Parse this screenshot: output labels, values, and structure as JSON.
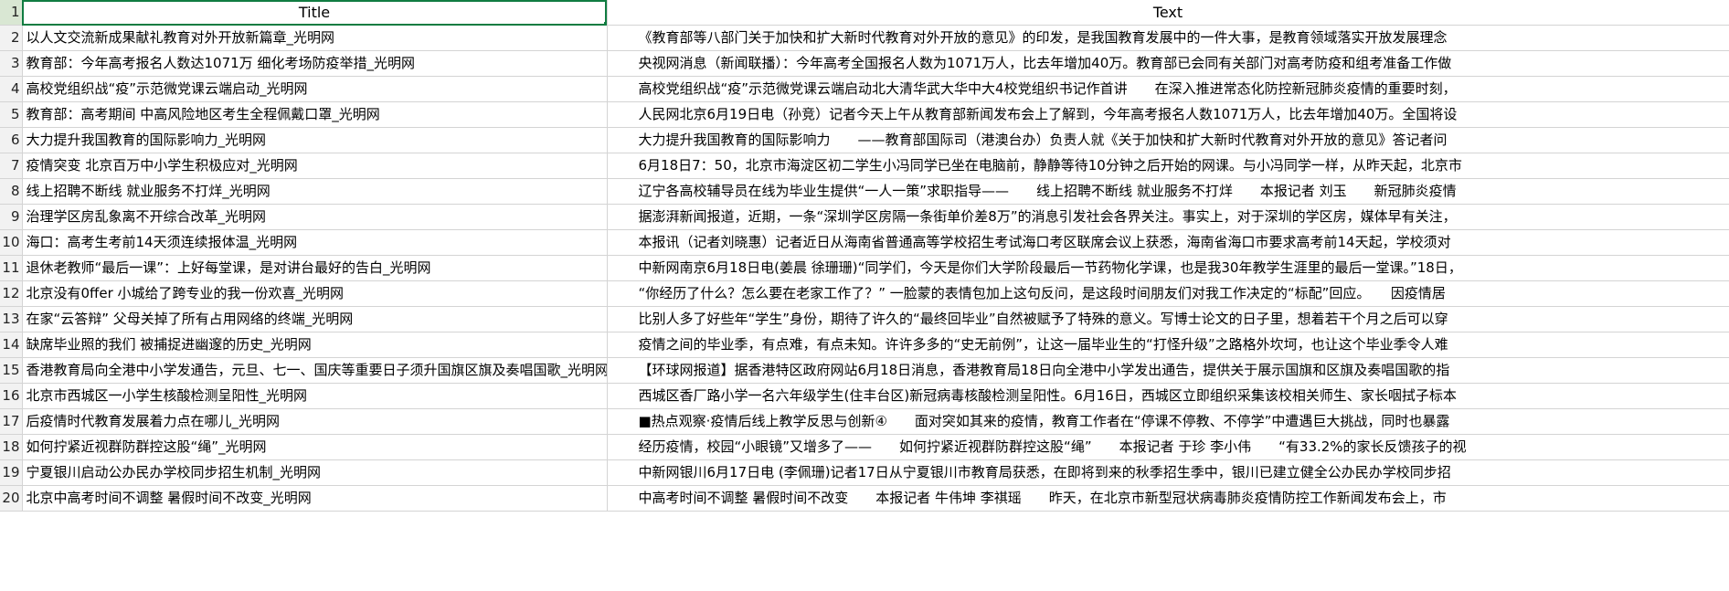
{
  "headers": {
    "title": "Title",
    "text": "Text"
  },
  "rows": [
    {
      "num": "1"
    },
    {
      "num": "2",
      "title": "以人文交流新成果献礼教育对外开放新篇章_光明网",
      "text": "《教育部等八部门关于加快和扩大新时代教育对外开放的意见》的印发，是我国教育发展中的一件大事，是教育领域落实开放发展理念"
    },
    {
      "num": "3",
      "title": "教育部：今年高考报名人数达1071万 细化考场防疫举措_光明网",
      "text": "央视网消息（新闻联播）：今年高考全国报名人数为1071万人，比去年增加40万。教育部已会同有关部门对高考防疫和组考准备工作做"
    },
    {
      "num": "4",
      "title": "高校党组织战“疫”示范微党课云端启动_光明网",
      "text": "高校党组织战“疫”示范微党课云端启动北大清华武大华中大4校党组织书记作首讲　　在深入推进常态化防控新冠肺炎疫情的重要时刻，"
    },
    {
      "num": "5",
      "title": "教育部：高考期间 中高风险地区考生全程佩戴口罩_光明网",
      "text": "人民网北京6月19日电（孙竞）记者今天上午从教育部新闻发布会上了解到，今年高考报名人数1071万人，比去年增加40万。全国将设"
    },
    {
      "num": "6",
      "title": "大力提升我国教育的国际影响力_光明网",
      "text": "大力提升我国教育的国际影响力　　——教育部国际司（港澳台办）负责人就《关于加快和扩大新时代教育对外开放的意见》答记者问"
    },
    {
      "num": "7",
      "title": "疫情突变 北京百万中小学生积极应对_光明网",
      "text": "6月18日7：50，北京市海淀区初二学生小冯同学已坐在电脑前，静静等待10分钟之后开始的网课。与小冯同学一样，从昨天起，北京市"
    },
    {
      "num": "8",
      "title": "线上招聘不断线 就业服务不打烊_光明网",
      "text": "辽宁各高校辅导员在线为毕业生提供“一人一策”求职指导——　　线上招聘不断线 就业服务不打烊　　本报记者 刘玉　　新冠肺炎疫情"
    },
    {
      "num": "9",
      "title": "治理学区房乱象离不开综合改革_光明网",
      "text": "据澎湃新闻报道，近期，一条“深圳学区房隔一条街单价差8万”的消息引发社会各界关注。事实上，对于深圳的学区房，媒体早有关注，"
    },
    {
      "num": "10",
      "title": "海口：高考生考前14天须连续报体温_光明网",
      "text": "本报讯（记者刘晓惠）记者近日从海南省普通高等学校招生考试海口考区联席会议上获悉，海南省海口市要求高考前14天起，学校须对"
    },
    {
      "num": "11",
      "title": "退休老教师“最后一课”：上好每堂课，是对讲台最好的告白_光明网",
      "text": "中新网南京6月18日电(姜晨 徐珊珊)“同学们，今天是你们大学阶段最后一节药物化学课，也是我30年教学生涯里的最后一堂课。”18日，"
    },
    {
      "num": "12",
      "title": "北京没有0ffer 小城给了跨专业的我一份欢喜_光明网",
      "text": "“你经历了什么？怎么要在老家工作了？” 一脸蒙的表情包加上这句反问，是这段时间朋友们对我工作决定的“标配”回应。　　因疫情居"
    },
    {
      "num": "13",
      "title": "在家“云答辩” 父母关掉了所有占用网络的终端_光明网",
      "text": "比别人多了好些年“学生”身份，期待了许久的“最终回毕业”自然被赋予了特殊的意义。写博士论文的日子里，想着若干个月之后可以穿"
    },
    {
      "num": "14",
      "title": "缺席毕业照的我们 被捕捉进幽邃的历史_光明网",
      "text": "疫情之间的毕业季，有点难，有点未知。许许多多的“史无前例”，让这一届毕业生的“打怪升级”之路格外坎坷，也让这个毕业季令人难"
    },
    {
      "num": "15",
      "title": "香港教育局向全港中小学发通告，元旦、七一、国庆等重要日子须升国旗区旗及奏唱国歌_光明网",
      "text": "【环球网报道】据香港特区政府网站6月18日消息，香港教育局18日向全港中小学发出通告，提供关于展示国旗和区旗及奏唱国歌的指"
    },
    {
      "num": "16",
      "title": "北京市西城区一小学生核酸检测呈阳性_光明网",
      "text": "西城区香厂路小学一名六年级学生(住丰台区)新冠病毒核酸检测呈阳性。6月16日，西城区立即组织采集该校相关师生、家长咽拭子标本"
    },
    {
      "num": "17",
      "title": "后疫情时代教育发展着力点在哪儿_光明网",
      "text": "■热点观察·疫情后线上教学反思与创新④　　面对突如其来的疫情，教育工作者在“停课不停教、不停学”中遭遇巨大挑战，同时也暴露"
    },
    {
      "num": "18",
      "title": "如何拧紧近视群防群控这股“绳”_光明网",
      "text": "经历疫情，校园“小眼镜”又增多了——　　如何拧紧近视群防群控这股“绳”　　本报记者 于珍 李小伟　　“有33.2%的家长反馈孩子的视"
    },
    {
      "num": "19",
      "title": "宁夏银川启动公办民办学校同步招生机制_光明网",
      "text": "中新网银川6月17日电 (李佩珊)记者17日从宁夏银川市教育局获悉，在即将到来的秋季招生季中，银川已建立健全公办民办学校同步招"
    },
    {
      "num": "20",
      "title": "北京中高考时间不调整 暑假时间不改变_光明网",
      "text": "中高考时间不调整 暑假时间不改变　　本报记者 牛伟坤 李祺瑶　　昨天，在北京市新型冠状病毒肺炎疫情防控工作新闻发布会上，市"
    }
  ]
}
